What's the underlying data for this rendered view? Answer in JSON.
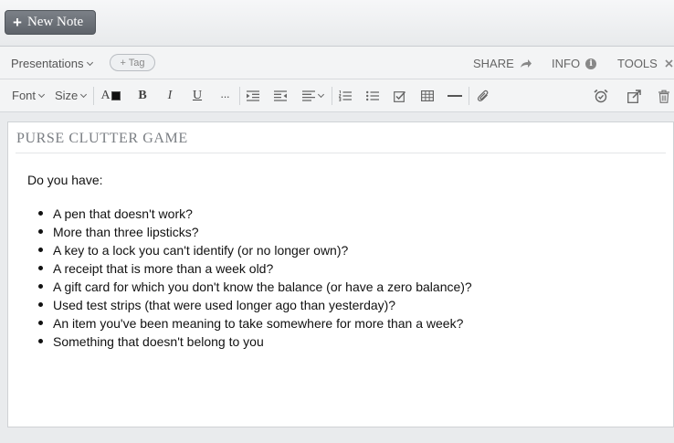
{
  "header": {
    "new_note_label": "New Note"
  },
  "note_bar": {
    "notebook": "Presentations",
    "tag_button": "+ Tag",
    "share": "SHARE",
    "info": "INFO",
    "tools": "TOOLS"
  },
  "toolbar": {
    "font": "Font",
    "size": "Size",
    "text_color": "A",
    "bold": "B",
    "italic": "I",
    "underline": "U",
    "more": "···"
  },
  "note": {
    "title": "PURSE CLUTTER GAME",
    "intro": "Do you have:",
    "items": [
      "A pen that doesn't work?",
      "More than three lipsticks?",
      "A key to a lock you can't identify (or no longer own)?",
      "A receipt that is more than a week old?",
      "A gift card for which you don't know the balance (or have a zero balance)?",
      "Used test strips (that were used longer ago than yesterday)?",
      "An item you've been meaning to take somewhere for more than a week?",
      "Something that doesn't belong to you"
    ]
  }
}
